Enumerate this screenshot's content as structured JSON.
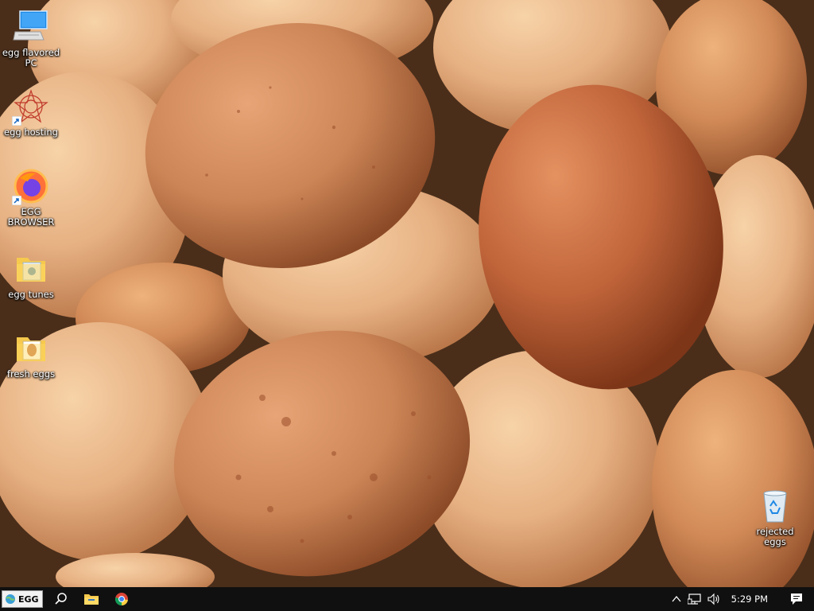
{
  "desktop": {
    "icons": [
      {
        "id": "pc",
        "label": "egg flavored PC"
      },
      {
        "id": "hosting",
        "label": "egg hosting"
      },
      {
        "id": "browser",
        "label": "EGG BROWSER"
      },
      {
        "id": "tunes",
        "label": "egg tunes"
      },
      {
        "id": "fresh",
        "label": "fresh eggs"
      },
      {
        "id": "recycle",
        "label": "rejected eggs"
      }
    ]
  },
  "taskbar": {
    "start_label": "EGG",
    "pinned": [
      "search-icon",
      "file-explorer-icon",
      "chrome-icon"
    ],
    "tray": {
      "icons": [
        "chevron-up-icon",
        "network-icon",
        "volume-icon",
        "notification-icon"
      ],
      "time": "5:29 PM"
    }
  },
  "colors": {
    "taskbar_bg": "#101010",
    "label_text": "#ffffff",
    "egg_brown": "#c77a4a"
  }
}
